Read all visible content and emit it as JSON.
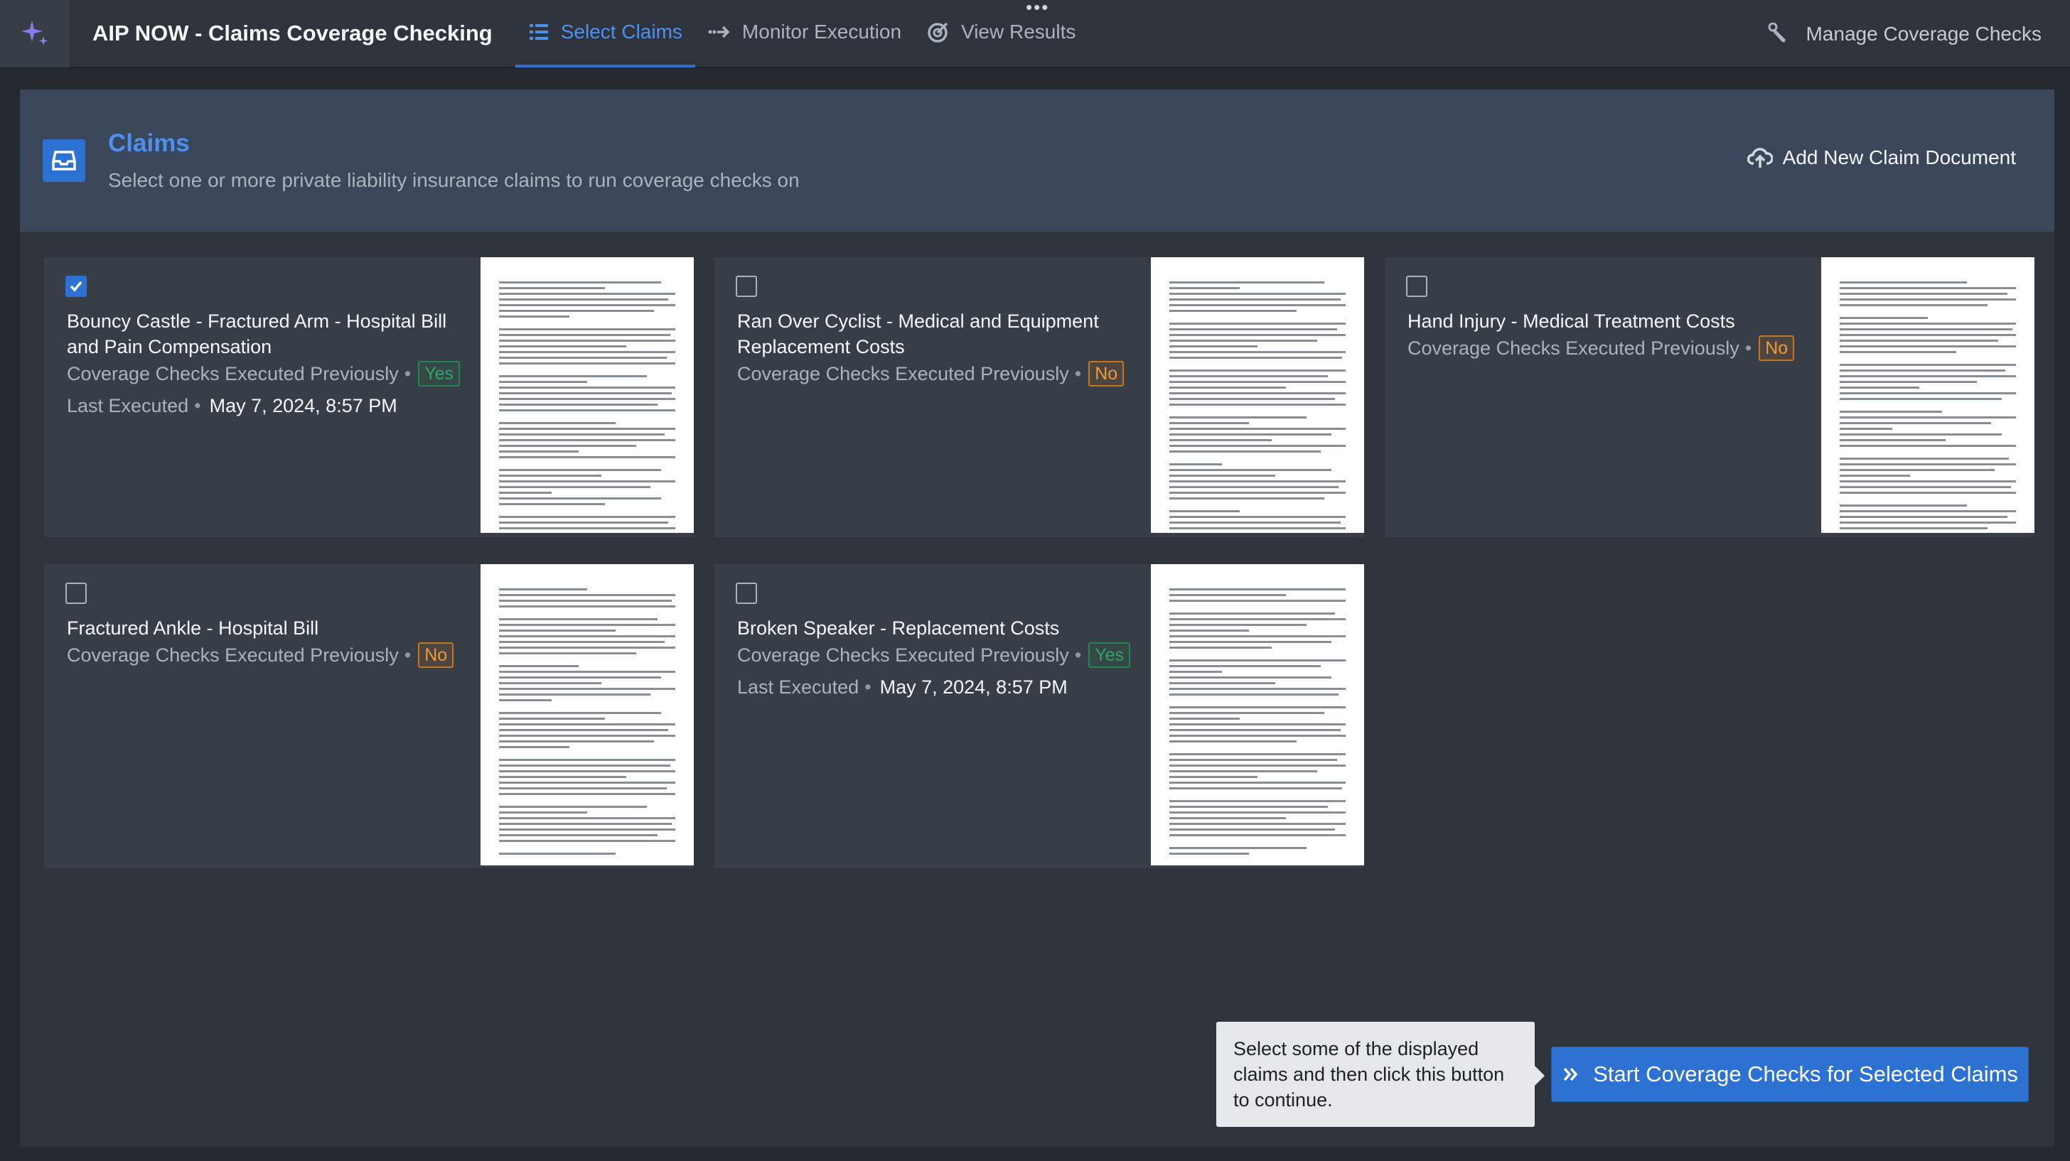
{
  "app": {
    "title": "AIP NOW - Claims Coverage Checking",
    "more_label": "•••"
  },
  "nav": {
    "tabs": [
      {
        "label": "Select Claims",
        "icon": "list-icon",
        "active": true
      },
      {
        "label": "Monitor Execution",
        "icon": "arrow-right-icon",
        "active": false
      },
      {
        "label": "View Results",
        "icon": "target-check-icon",
        "active": false
      }
    ],
    "manage_label": "Manage Coverage Checks"
  },
  "header": {
    "title": "Claims",
    "subtitle": "Select one or more private liability insurance claims to run coverage checks on",
    "add_label": "Add New Claim Document",
    "icon": "inbox-icon"
  },
  "claims": [
    {
      "title": "Bouncy Castle - Fractured Arm - Hospital Bill and Pain Compensation",
      "checked": true,
      "executed_label": "Coverage Checks Executed Previously",
      "executed": "Yes",
      "last_label": "Last Executed",
      "last_value": "May 7, 2024, 8:57 PM"
    },
    {
      "title": "Ran Over Cyclist - Medical and Equipment Replacement Costs",
      "checked": false,
      "executed_label": "Coverage Checks Executed Previously",
      "executed": "No"
    },
    {
      "title": "Hand Injury - Medical Treatment Costs",
      "checked": false,
      "executed_label": "Coverage Checks Executed Previously",
      "executed": "No"
    },
    {
      "title": "Fractured Ankle - Hospital Bill",
      "checked": false,
      "executed_label": "Coverage Checks Executed Previously",
      "executed": "No"
    },
    {
      "title": "Broken Speaker - Replacement Costs",
      "checked": false,
      "executed_label": "Coverage Checks Executed Previously",
      "executed": "Yes",
      "last_label": "Last Executed",
      "last_value": "May 7, 2024, 8:57 PM"
    }
  ],
  "footer": {
    "tooltip": "Select some of the displayed claims and then click this button to continue.",
    "start_label": "Start Coverage Checks for Selected Claims"
  },
  "colors": {
    "accent": "#2d72d2",
    "yes": "#32a467",
    "no": "#ec9a3c"
  }
}
